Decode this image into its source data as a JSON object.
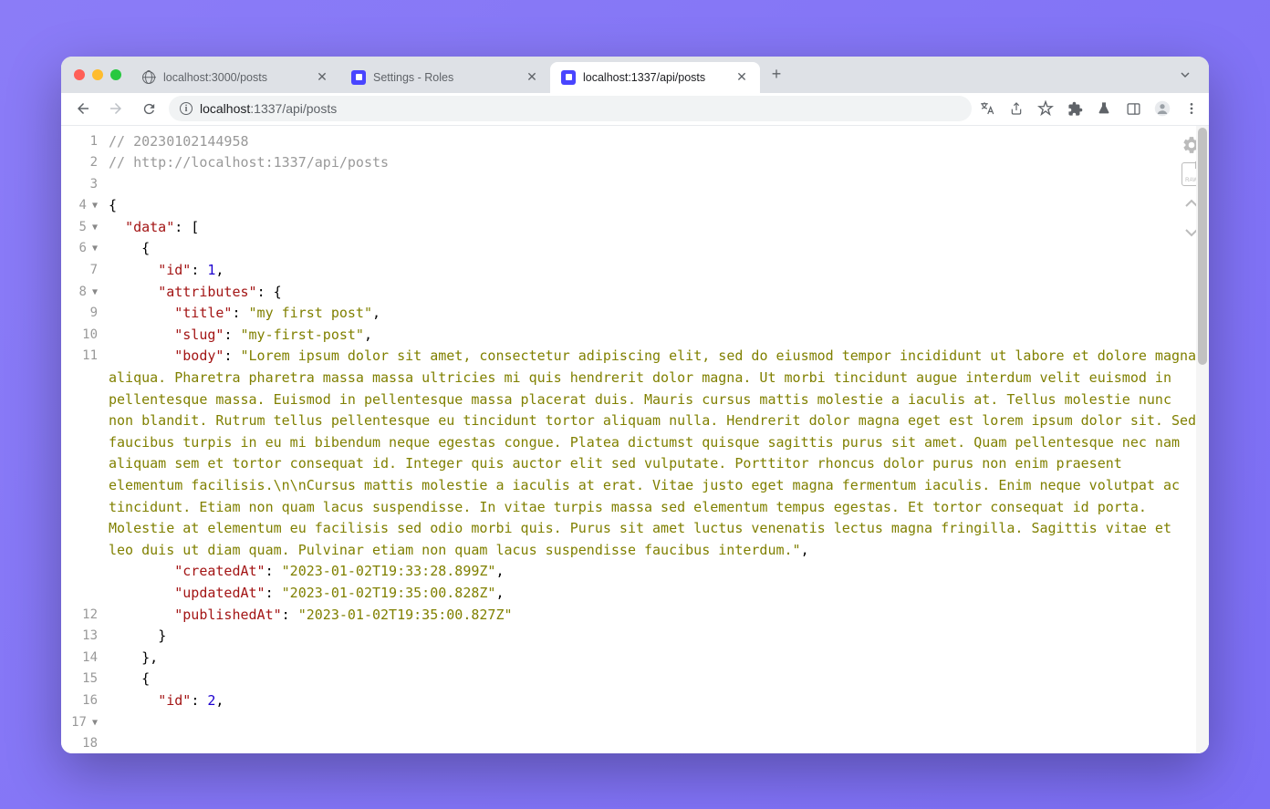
{
  "tabs": [
    {
      "title": "localhost:3000/posts",
      "favicon": "globe",
      "active": false
    },
    {
      "title": "Settings - Roles",
      "favicon": "strapi",
      "active": false
    },
    {
      "title": "localhost:1337/api/posts",
      "favicon": "strapi",
      "active": true
    }
  ],
  "url": {
    "host": "localhost",
    "rest": ":1337/api/posts"
  },
  "json_viewer": {
    "comment_timestamp": "// 20230102144958",
    "comment_url": "// http://localhost:1337/api/posts",
    "lines": [
      "1",
      "2",
      "3",
      "4",
      "5",
      "6",
      "7",
      "8",
      "9",
      "10",
      "11",
      "12",
      "13",
      "14",
      "15",
      "16",
      "17",
      "18"
    ],
    "fold_lines": [
      4,
      5,
      6,
      8,
      17
    ],
    "response": {
      "data": [
        {
          "id": 1,
          "attributes": {
            "title": "my first post",
            "slug": "my-first-post",
            "body": "Lorem ipsum dolor sit amet, consectetur adipiscing elit, sed do eiusmod tempor incididunt ut labore et dolore magna aliqua. Pharetra pharetra massa massa ultricies mi quis hendrerit dolor magna. Ut morbi tincidunt augue interdum velit euismod in pellentesque massa. Euismod in pellentesque massa placerat duis. Mauris cursus mattis molestie a iaculis at. Tellus molestie nunc non blandit. Rutrum tellus pellentesque eu tincidunt tortor aliquam nulla. Hendrerit dolor magna eget est lorem ipsum dolor sit. Sed faucibus turpis in eu mi bibendum neque egestas congue. Platea dictumst quisque sagittis purus sit amet. Quam pellentesque nec nam aliquam sem et tortor consequat id. Integer quis auctor elit sed vulputate. Porttitor rhoncus dolor purus non enim praesent elementum facilisis.\\n\\nCursus mattis molestie a iaculis at erat. Vitae justo eget magna fermentum iaculis. Enim neque volutpat ac tincidunt. Etiam non quam lacus suspendisse. In vitae turpis massa sed elementum tempus egestas. Et tortor consequat id porta. Molestie at elementum eu facilisis sed odio morbi quis. Purus sit amet luctus venenatis lectus magna fringilla. Sagittis vitae et leo duis ut diam quam. Pulvinar etiam non quam lacus suspendisse faucibus interdum.",
            "createdAt": "2023-01-02T19:33:28.899Z",
            "updatedAt": "2023-01-02T19:35:00.828Z",
            "publishedAt": "2023-01-02T19:35:00.827Z"
          }
        },
        {
          "id": 2
        }
      ]
    }
  },
  "raw_label": "RAW"
}
